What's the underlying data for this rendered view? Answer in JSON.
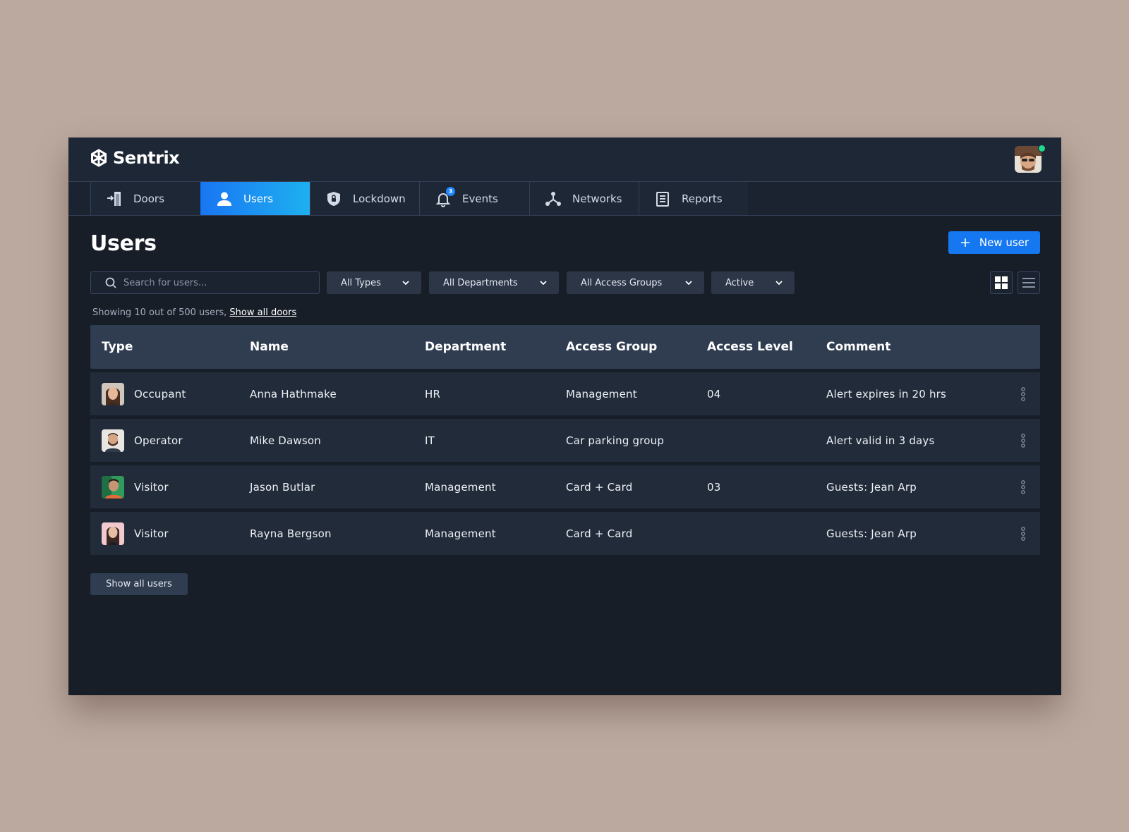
{
  "app": {
    "name": "Sentrix"
  },
  "tabs": [
    {
      "label": "Doors",
      "icon": "door-icon",
      "active": false
    },
    {
      "label": "Users",
      "icon": "user-icon",
      "active": true
    },
    {
      "label": "Lockdown",
      "icon": "shield-lock-icon",
      "active": false
    },
    {
      "label": "Events",
      "icon": "bell-icon",
      "active": false,
      "badge": "3"
    },
    {
      "label": "Networks",
      "icon": "network-icon",
      "active": false
    },
    {
      "label": "Reports",
      "icon": "report-icon",
      "active": false
    }
  ],
  "page": {
    "title": "Users",
    "new_user_label": "New user",
    "new_user_icon": "+"
  },
  "search": {
    "placeholder": "Search for users..."
  },
  "filters": [
    {
      "label": "All Types"
    },
    {
      "label": "All Departments"
    },
    {
      "label": "All Access Groups"
    },
    {
      "label": "Active"
    }
  ],
  "summary": {
    "text": "Showing 10 out of 500 users,",
    "link": "Show all doors"
  },
  "table": {
    "columns": [
      "Type",
      "Name",
      "Department",
      "Access Group",
      "Access Level",
      "Comment"
    ],
    "rows": [
      {
        "type": "Occupant",
        "name": "Anna Hathmake",
        "department": "HR",
        "access_group": "Management",
        "access_level": "04",
        "comment": "Alert expires in 20 hrs",
        "avatar": "avatar-anna"
      },
      {
        "type": "Operator",
        "name": "Mike Dawson",
        "department": "IT",
        "access_group": "Car parking group",
        "access_level": "",
        "comment": "Alert valid in 3 days",
        "avatar": "avatar-mike"
      },
      {
        "type": "Visitor",
        "name": "Jason Butlar",
        "department": "Management",
        "access_group": "Card + Card",
        "access_level": "03",
        "comment": "Guests: Jean Arp",
        "avatar": "avatar-jason"
      },
      {
        "type": "Visitor",
        "name": "Rayna Bergson",
        "department": "Management",
        "access_group": "Card + Card",
        "access_level": "",
        "comment": "Guests: Jean Arp",
        "avatar": "avatar-rayna"
      }
    ]
  },
  "footer": {
    "show_all_label": "Show all users"
  },
  "colors": {
    "accent": "#1578f0",
    "online": "#1ed98e",
    "background": "#181e28",
    "header": "#303d51"
  }
}
